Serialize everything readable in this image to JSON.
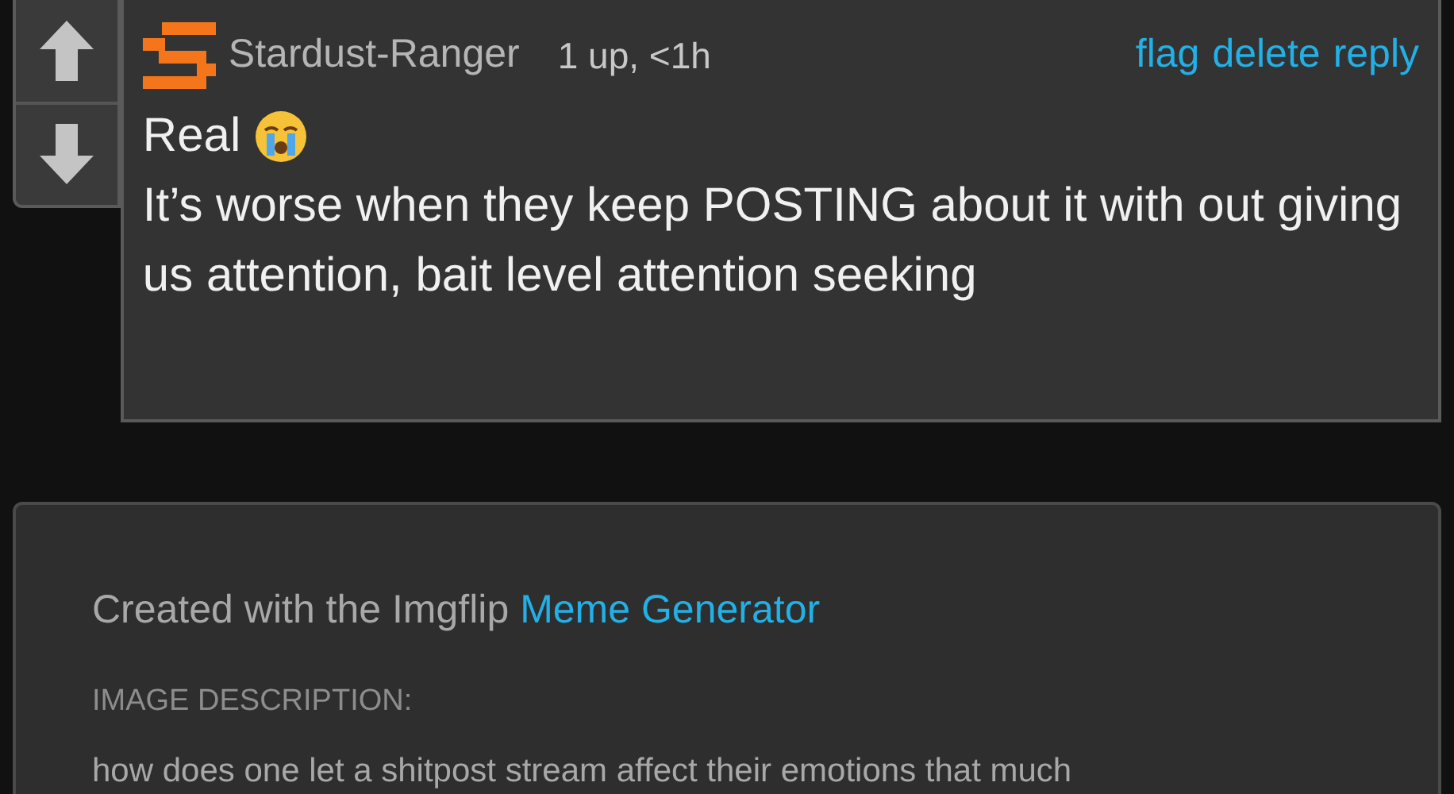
{
  "comment": {
    "username": "Stardust-Ranger",
    "meta": "1 up, <1h",
    "actions": [
      "flag",
      "delete",
      "reply"
    ],
    "lines": [
      "Real",
      "It’s worse when they keep POSTING about it with out giving us attention, bait level attention seeking"
    ]
  },
  "footer": {
    "created": "Created with the Imgflip",
    "link": "Meme Generator",
    "description_label": "IMAGE DESCRIPTION:",
    "description": "how does one let a shitpost stream affect their emotions that much"
  }
}
